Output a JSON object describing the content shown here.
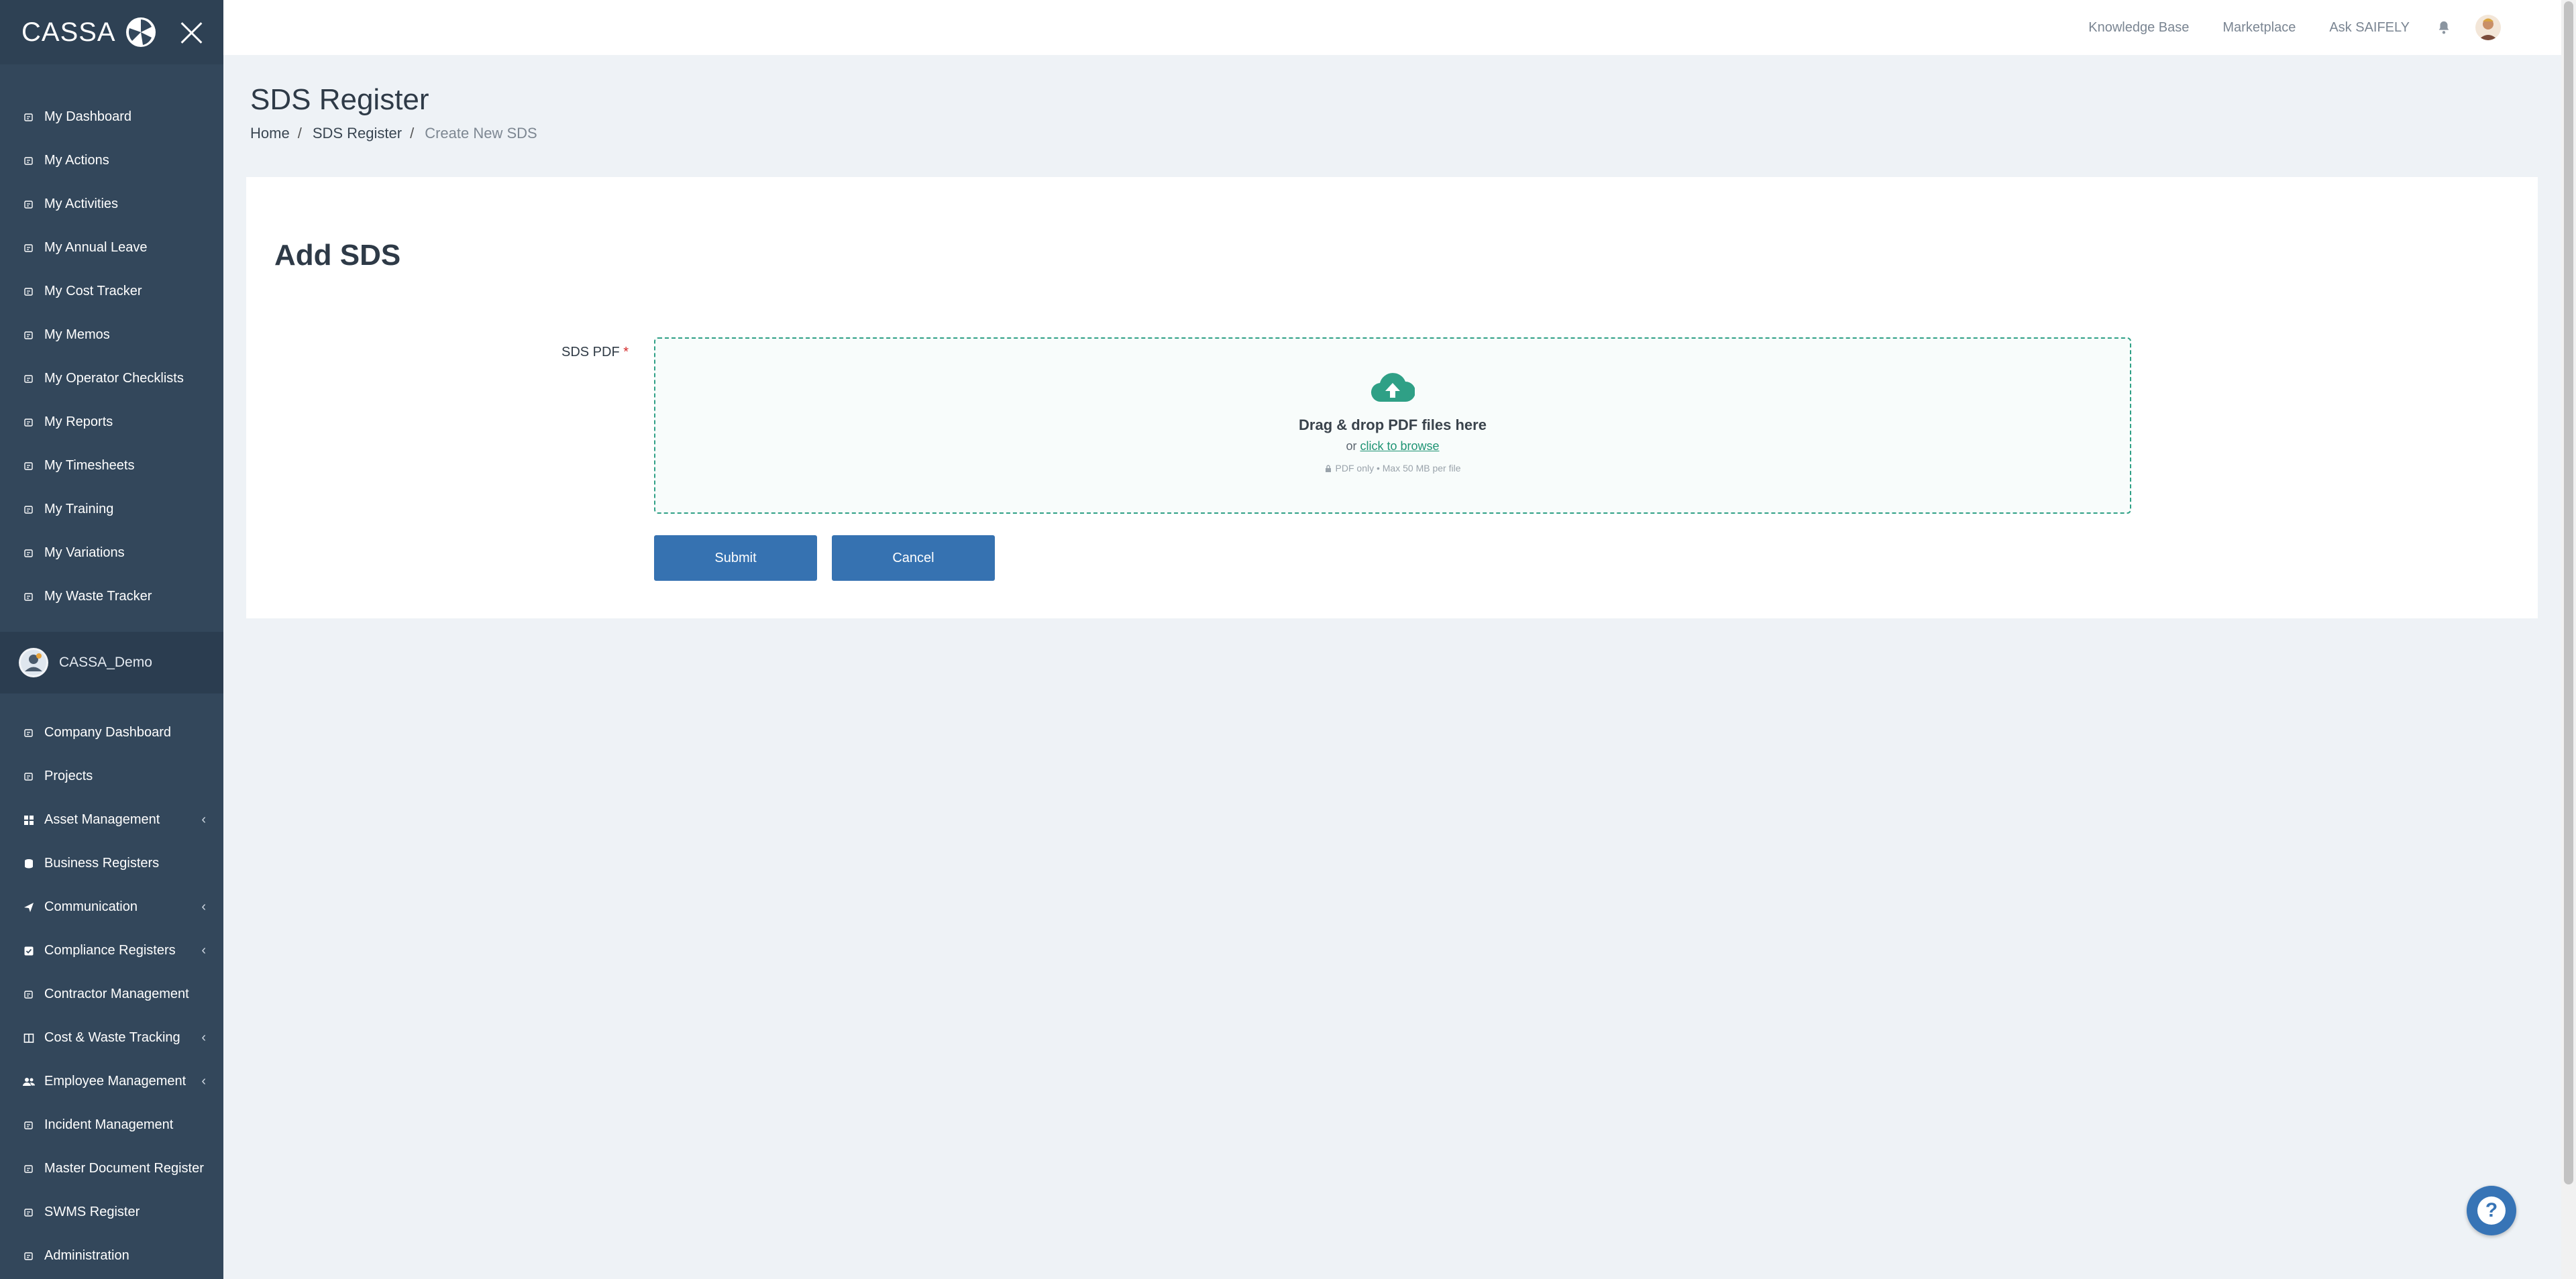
{
  "sidebar": {
    "logo_text": "CASSA",
    "top_items": [
      {
        "label": "My Dashboard",
        "icon": "dashboard-icon"
      },
      {
        "label": "My Actions",
        "icon": "actions-icon"
      },
      {
        "label": "My Activities",
        "icon": "activities-icon"
      },
      {
        "label": "My Annual Leave",
        "icon": "leave-icon"
      },
      {
        "label": "My Cost Tracker",
        "icon": "cost-icon"
      },
      {
        "label": "My Memos",
        "icon": "memo-icon"
      },
      {
        "label": "My Operator Checklists",
        "icon": "checklist-icon"
      },
      {
        "label": "My Reports",
        "icon": "report-icon"
      },
      {
        "label": "My Timesheets",
        "icon": "timesheet-icon"
      },
      {
        "label": "My Training",
        "icon": "training-icon"
      },
      {
        "label": "My Variations",
        "icon": "variation-icon"
      },
      {
        "label": "My Waste Tracker",
        "icon": "waste-icon"
      }
    ],
    "company": "CASSA_Demo",
    "bottom_items": [
      {
        "label": "Company Dashboard",
        "icon": "company-dashboard-icon"
      },
      {
        "label": "Projects",
        "icon": "projects-icon"
      },
      {
        "label": "Asset Management",
        "icon": "grid-icon"
      },
      {
        "label": "Business Registers",
        "icon": "database-icon"
      },
      {
        "label": "Communication",
        "icon": "send-icon"
      },
      {
        "label": "Compliance Registers",
        "icon": "check-square-icon"
      },
      {
        "label": "Contractor Management",
        "icon": "contractor-icon"
      },
      {
        "label": "Cost & Waste Tracking",
        "icon": "columns-icon"
      },
      {
        "label": "Employee Management",
        "icon": "users-icon"
      },
      {
        "label": "Incident Management",
        "icon": "incident-icon"
      },
      {
        "label": "Master Document Register",
        "icon": "document-icon"
      },
      {
        "label": "SWMS Register",
        "icon": "swms-icon"
      },
      {
        "label": "Administration",
        "icon": "admin-icon"
      }
    ]
  },
  "topbar": {
    "links": [
      "Knowledge Base",
      "Marketplace",
      "Ask SAIFELY"
    ]
  },
  "page": {
    "title": "SDS Register",
    "breadcrumb": [
      "Home",
      "SDS Register",
      "Create New SDS"
    ]
  },
  "form": {
    "title": "Add SDS",
    "field_label": "SDS PDF",
    "required_mark": "*",
    "dropzone_title": "Drag & drop PDF files here",
    "dropzone_or": "or",
    "dropzone_browse": "click to browse",
    "dropzone_note": "PDF only • Max 50 MB per file",
    "submit_label": "Submit",
    "cancel_label": "Cancel"
  },
  "help": {
    "label": "?"
  },
  "colors": {
    "sidebar_bg": "#33475b",
    "accent_green": "#2fa086",
    "button_blue": "#3672b1"
  }
}
